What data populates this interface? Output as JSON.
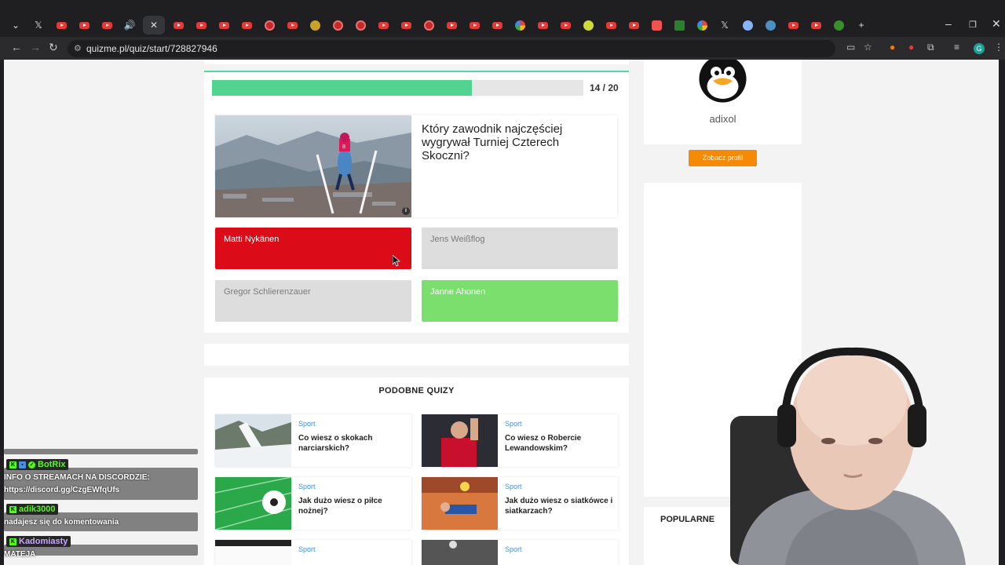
{
  "browser": {
    "url": "quizme.pl/quiz/start/728827946",
    "tab_close": "✕",
    "new_tab": "+"
  },
  "quiz": {
    "progress_label": "14 / 20",
    "progress_fraction": 0.7,
    "question": "Który zawodnik najczęściej wygrywał Turniej Czterech Skoczni?",
    "answers": [
      {
        "label": "Matti Nykänen",
        "state": "wrong-selected"
      },
      {
        "label": "Jens Weißflog",
        "state": "neutral"
      },
      {
        "label": "Gregor Schlierenzauer",
        "state": "neutral"
      },
      {
        "label": "Janne Ahonen",
        "state": "correct"
      }
    ]
  },
  "similar": {
    "title": "PODOBNE QUIZY",
    "items": [
      {
        "category": "Sport",
        "title": "Co wiesz o skokach narciarskich?"
      },
      {
        "category": "Sport",
        "title": "Co wiesz o Robercie Lewandowskim?"
      },
      {
        "category": "Sport",
        "title": "Jak dużo wiesz o piłce nożnej?"
      },
      {
        "category": "Sport",
        "title": "Jak dużo wiesz o siatkówce i siatkarzach?"
      },
      {
        "category": "Sport",
        "title": ""
      },
      {
        "category": "Sport",
        "title": ""
      }
    ]
  },
  "profile": {
    "username": "adixol",
    "button_label": "Zobacz profil"
  },
  "popular": {
    "title": "POPULARNE"
  },
  "chat": {
    "messages": [
      {
        "user": "BotRix",
        "user_color": "#53fc18",
        "text": "INFO O STREAMACH NA DISCORDZIE: https://discord.gg/CzgEWfqUfs"
      },
      {
        "user": "adik3000",
        "user_color": "#53fc18",
        "text": "nadajesz się do komentowania"
      },
      {
        "user": "Kadomiasty",
        "user_color": "#c9a7ff",
        "text": "MATEJA"
      }
    ]
  },
  "colors": {
    "progress": "#52d38f",
    "wrong": "#db0b18",
    "correct": "#7adf6d",
    "button": "#f58a07",
    "category": "#3b8fd9"
  }
}
